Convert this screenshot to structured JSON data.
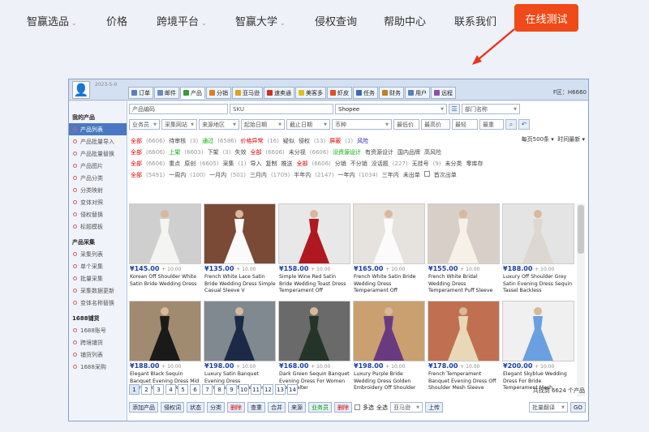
{
  "nav": {
    "items": [
      {
        "label": "智赢选品",
        "dropdown": true
      },
      {
        "label": "价格",
        "dropdown": false
      },
      {
        "label": "跨境平台",
        "dropdown": true
      },
      {
        "label": "智赢大学",
        "dropdown": true
      },
      {
        "label": "侵权查询",
        "dropdown": false
      },
      {
        "label": "帮助中心",
        "dropdown": false
      },
      {
        "label": "联系我们",
        "dropdown": false
      }
    ],
    "cta": "在线测试"
  },
  "window": {
    "date": "2023-5-9",
    "id_label": "F区：H6660",
    "tabs": [
      {
        "label": "订单",
        "color": "#5b7fb8"
      },
      {
        "label": "邮件",
        "color": "#6b8ac0"
      },
      {
        "label": "产品",
        "color": "#3a9a3a"
      },
      {
        "label": "分销",
        "color": "#e07a20"
      },
      {
        "label": "亚马逊",
        "color": "#e0a020"
      },
      {
        "label": "速卖通",
        "color": "#d03020"
      },
      {
        "label": "美客多",
        "color": "#e0c020"
      },
      {
        "label": "虾皮",
        "color": "#e05020"
      },
      {
        "label": "任务",
        "color": "#3a6ab0"
      },
      {
        "label": "财务",
        "color": "#c08020"
      },
      {
        "label": "用户",
        "color": "#5b7fb8"
      },
      {
        "label": "远程",
        "color": "#8a50b0"
      }
    ],
    "sidebar": [
      {
        "title": "我的产品",
        "items": [
          "产品列表",
          "产品批量导入",
          "产品批量替换",
          "产品图片",
          "产品分类",
          "分类映射",
          "变体对照",
          "侵权替换",
          "标题模板"
        ]
      },
      {
        "title": "产品采集",
        "items": [
          "采集列表",
          "单个采集",
          "批量采集",
          "采集数据更新",
          "变体名称替换"
        ]
      },
      {
        "title": "1688铺货",
        "items": [
          "1688账号",
          "跨境铺货",
          "铺货列表",
          "1688采购"
        ]
      }
    ],
    "filters": {
      "product_code": "产品编码",
      "sku": "SKU",
      "platform": "Shopee",
      "dept": "部门名称",
      "row2": [
        "业务员",
        "采集网站",
        "来源地区",
        "起始日期",
        "截止日期",
        "币种",
        "最低价",
        "最高价",
        "最轻",
        "最重"
      ]
    },
    "prop_rows": [
      [
        {
          "t": "全部",
          "c": "r"
        },
        {
          "t": "(6606)",
          "c": "gr"
        },
        {
          "t": "待审核",
          "c": ""
        },
        {
          "t": "(3)",
          "c": "gr"
        },
        {
          "t": "通过",
          "c": "g"
        },
        {
          "t": "(6586)",
          "c": "gr"
        },
        {
          "t": "价格异常",
          "c": "r"
        },
        {
          "t": "(16)",
          "c": "gr"
        },
        {
          "t": "疑似",
          "c": ""
        },
        {
          "t": "侵权",
          "c": ""
        },
        {
          "t": "(13)",
          "c": "gr"
        },
        {
          "t": "屏蔽",
          "c": "r"
        },
        {
          "t": "(1)",
          "c": "gr"
        },
        {
          "t": "风险",
          "c": "b"
        }
      ],
      [
        {
          "t": "全部",
          "c": "r"
        },
        {
          "t": "(6606)",
          "c": "gr"
        },
        {
          "t": "上架",
          "c": "g"
        },
        {
          "t": "(6603)",
          "c": "gr"
        },
        {
          "t": "下架",
          "c": ""
        },
        {
          "t": "(3)",
          "c": "gr"
        },
        {
          "t": "失效",
          "c": ""
        },
        {
          "t": "全部",
          "c": "r"
        },
        {
          "t": "(6606)",
          "c": "gr"
        },
        {
          "t": "未分视",
          "c": ""
        },
        {
          "t": "(6606)",
          "c": "gr"
        },
        {
          "t": "没资源设计",
          "c": "g"
        },
        {
          "t": "有资源设计",
          "c": ""
        },
        {
          "t": "国内品牌",
          "c": ""
        },
        {
          "t": "高风险",
          "c": ""
        }
      ],
      [
        {
          "t": "全部",
          "c": "r"
        },
        {
          "t": "(6606)",
          "c": "gr"
        },
        {
          "t": "重点",
          "c": ""
        },
        {
          "t": "原创",
          "c": ""
        },
        {
          "t": "(6605)",
          "c": "gr"
        },
        {
          "t": "采集",
          "c": ""
        },
        {
          "t": "(1)",
          "c": "gr"
        },
        {
          "t": "导入",
          "c": ""
        },
        {
          "t": "复制",
          "c": ""
        },
        {
          "t": "推送",
          "c": ""
        },
        {
          "t": "全部",
          "c": "r"
        },
        {
          "t": "(6606)",
          "c": "gr"
        },
        {
          "t": "分销",
          "c": ""
        },
        {
          "t": "不分销",
          "c": ""
        },
        {
          "t": "没话题",
          "c": ""
        },
        {
          "t": "(227)",
          "c": "gr"
        },
        {
          "t": "无挂号",
          "c": ""
        },
        {
          "t": "(9)",
          "c": "gr"
        },
        {
          "t": "未分类",
          "c": ""
        },
        {
          "t": "零库存",
          "c": ""
        }
      ],
      [
        {
          "t": "全部",
          "c": "r"
        },
        {
          "t": "(5491)",
          "c": "gr"
        },
        {
          "t": "一周内",
          "c": ""
        },
        {
          "t": "(100)",
          "c": "gr"
        },
        {
          "t": "一月内",
          "c": ""
        },
        {
          "t": "(501)",
          "c": "gr"
        },
        {
          "t": "三月内",
          "c": ""
        },
        {
          "t": "(1709)",
          "c": "gr"
        },
        {
          "t": "半年内",
          "c": ""
        },
        {
          "t": "(2147)",
          "c": "gr"
        },
        {
          "t": "一年内",
          "c": ""
        },
        {
          "t": "(1034)",
          "c": "gr"
        },
        {
          "t": "三年内",
          "c": ""
        },
        {
          "t": "未出单",
          "c": ""
        },
        {
          "t": "首次出单",
          "c": ""
        }
      ]
    ],
    "per_page": "每页500条",
    "sort": "时间最新",
    "products": [
      {
        "price": "¥145.00",
        "cost": "+ 10.00",
        "title": "Korean Off Shoulder White Satin Bride Wedding Dress",
        "bg": "#cfcfcf",
        "dress": "#f4f4f2"
      },
      {
        "price": "¥135.00",
        "cost": "+ 10.00",
        "title": "French White Lace Satin Bride Wedding Dress Simple Casual Sleeve V",
        "bg": "#7a4a36",
        "dress": "#fafafa"
      },
      {
        "price": "¥158.00",
        "cost": "+ 10.00",
        "title": "Simple Wine Red Satin Bride Wedding Toast Dress Temperament Off",
        "bg": "#e8e8e8",
        "dress": "#b01820"
      },
      {
        "price": "¥165.00",
        "cost": "+ 10.00",
        "title": "French White Satin Bride Wedding Dress Temperament Off",
        "bg": "#e6e3df",
        "dress": "#fbfbfb"
      },
      {
        "price": "¥155.00",
        "cost": "+ 10.00",
        "title": "French White Bridal Wedding Dress Temperament Puff Sleeve",
        "bg": "#d8d0c8",
        "dress": "#f6f0e6"
      },
      {
        "price": "¥188.00",
        "cost": "+ 10.00",
        "title": "Luxury Off Shoulder Grey Satin Evening Dress Sequin Tassel Backless",
        "bg": "#e4e4e4",
        "dress": "#dcd8d0"
      },
      {
        "price": "¥188.00",
        "cost": "+ 10.00",
        "title": "Elegant Black Sequin Banquet Evening Dress Mid Sleeve Round Neck",
        "bg": "#a08a70",
        "dress": "#1a1a1a"
      },
      {
        "price": "¥198.00",
        "cost": "+ 10.00",
        "title": "Luxury Satin Banquet Evening Dress Temperament Sleeveless",
        "bg": "#808890",
        "dress": "#1c2a48"
      },
      {
        "price": "¥168.00",
        "cost": "+ 10.00",
        "title": "Dark Green Sequin Banquet Evening Dress For Women Sexy Halter",
        "bg": "#6a6a6a",
        "dress": "#243428"
      },
      {
        "price": "¥198.00",
        "cost": "+ 10.00",
        "title": "Luxury Purple Bride Wedding Dress Golden Embroidery Off Shoulder",
        "bg": "#caa070",
        "dress": "#6a3a80"
      },
      {
        "price": "¥178.00",
        "cost": "+ 10.00",
        "title": "French Temperament Banquet Evening Dress Off Shoulder Mesh Sleeve",
        "bg": "#c07050",
        "dress": "#e8d8b8"
      },
      {
        "price": "¥200.00",
        "cost": "+ 10.00",
        "title": "Elegant Skyblue Wedding Dress For Bride Temperament Mesh",
        "bg": "#f0f0f0",
        "dress": "#6aa0e0"
      }
    ],
    "pages": [
      "1",
      "2",
      "3",
      "4",
      "5",
      "6",
      "7",
      "8",
      "9",
      "10",
      "11",
      "12",
      "13",
      "14"
    ],
    "found": "共找到 6624 个产品",
    "bottom_buttons": [
      {
        "t": "添加产品",
        "k": ""
      },
      {
        "t": "侵权词",
        "k": ""
      },
      {
        "t": "状态",
        "k": ""
      },
      {
        "t": "分类",
        "k": ""
      },
      {
        "t": "删除",
        "k": "warn"
      },
      {
        "t": "查重",
        "k": ""
      },
      {
        "t": "合并",
        "k": ""
      },
      {
        "t": "来源",
        "k": ""
      },
      {
        "t": "业务员",
        "k": "green"
      },
      {
        "t": "删除",
        "k": "warn"
      }
    ],
    "multi": "多选",
    "select_all": "全选",
    "store": "亚马逊",
    "upload": "上传",
    "batch": "批量翻译",
    "go": "GO"
  }
}
